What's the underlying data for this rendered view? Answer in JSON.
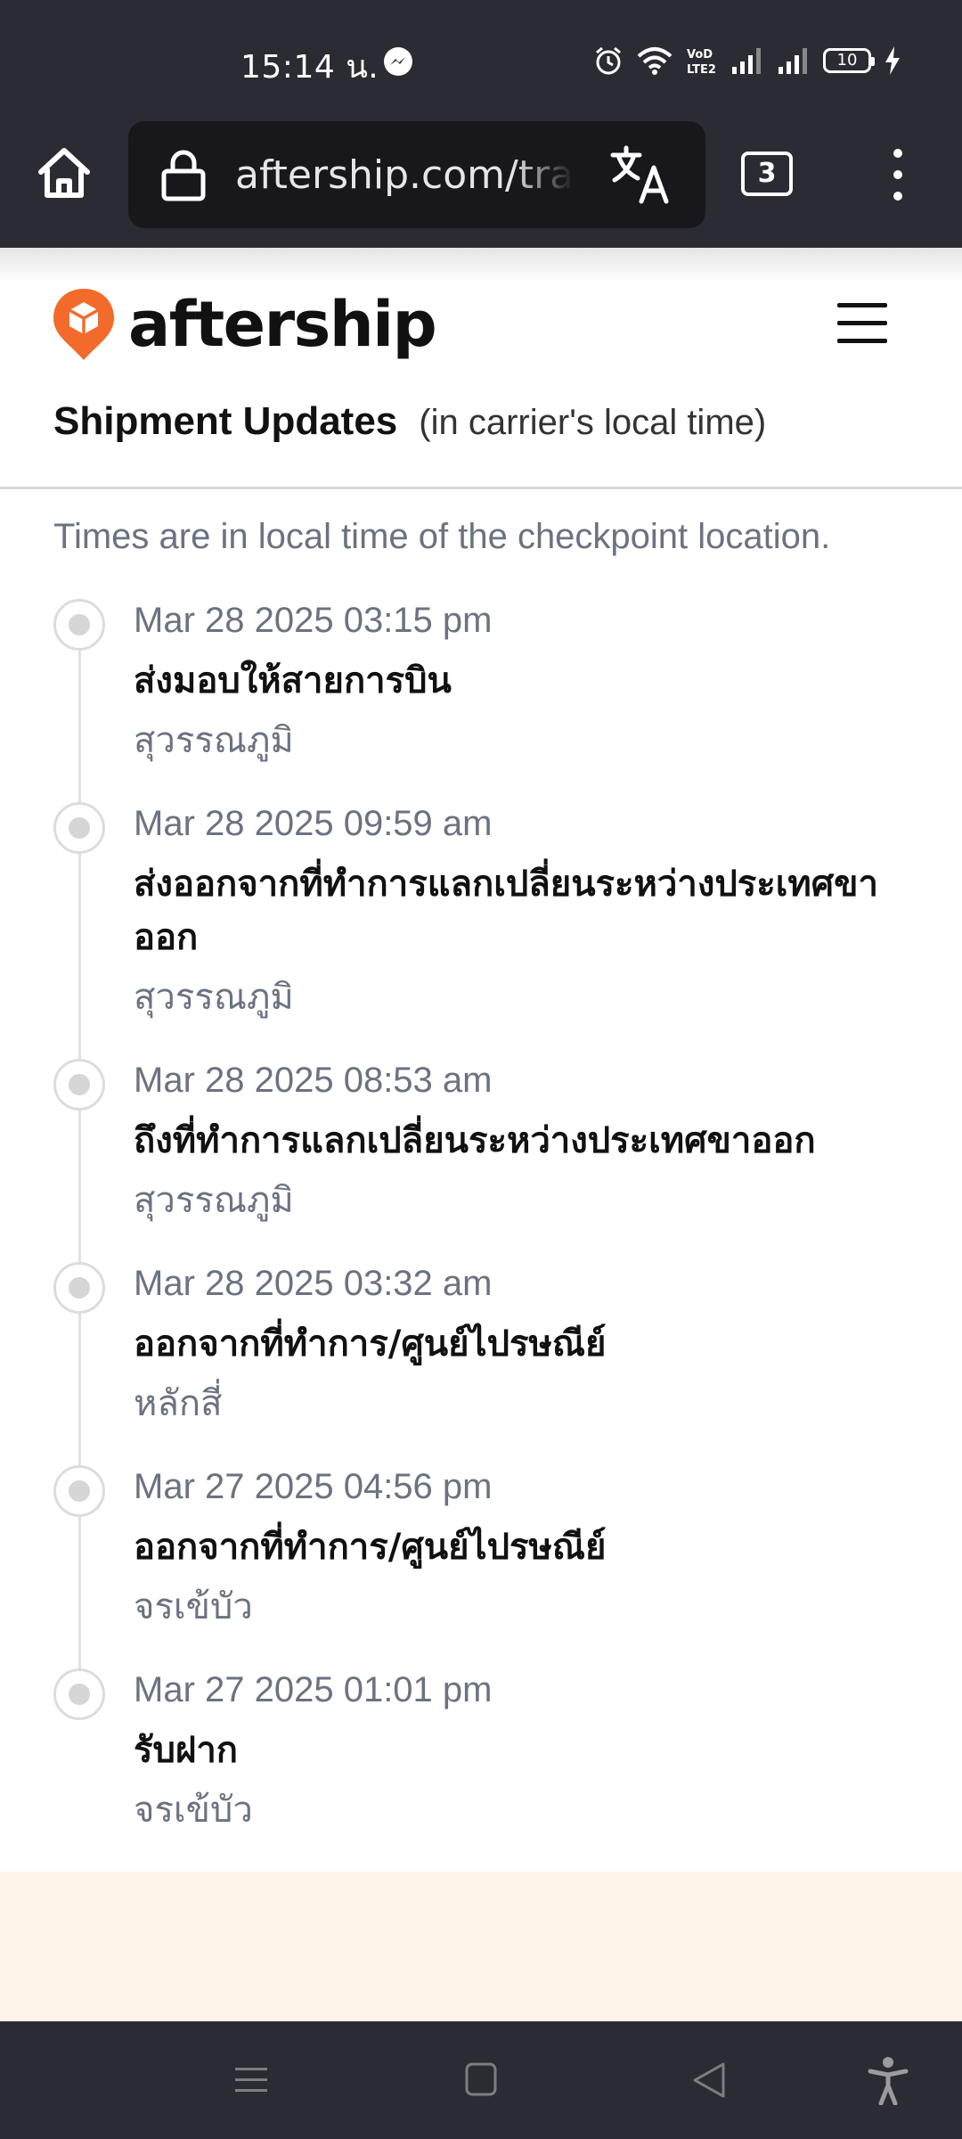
{
  "status_bar": {
    "time": "15:14 น.",
    "battery": "10",
    "icons": [
      "messenger-icon",
      "alarm-icon",
      "wifi-icon",
      "volte-icon",
      "signal-icon",
      "signal-icon",
      "battery-icon",
      "charging-icon"
    ]
  },
  "browser": {
    "url": "aftership.com/track",
    "tab_count": "3",
    "icons": [
      "home-icon",
      "lock-icon",
      "translate-icon",
      "more-icon"
    ]
  },
  "header": {
    "brand": "aftership",
    "brand_color": "#f26b2a",
    "icons": [
      "aftership-logo-icon",
      "hamburger-icon"
    ]
  },
  "section": {
    "title": "Shipment Updates",
    "subtitle": "(in carrier's local time)",
    "note": "Times are in local time of the checkpoint location."
  },
  "checkpoints": [
    {
      "time": "Mar 28 2025 03:15 pm",
      "status": "ส่งมอบให้สายการบิน",
      "location": "สุวรรณภูมิ"
    },
    {
      "time": "Mar 28 2025 09:59 am",
      "status": "ส่งออกจากที่ทำการแลกเปลี่ยนระหว่างประเทศขาออก",
      "location": "สุวรรณภูมิ"
    },
    {
      "time": "Mar 28 2025 08:53 am",
      "status": "ถึงที่ทำการแลกเปลี่ยนระหว่างประเทศขาออก",
      "location": "สุวรรณภูมิ"
    },
    {
      "time": "Mar 28 2025 03:32 am",
      "status": "ออกจากที่ทำการ/ศูนย์ไปรษณีย์",
      "location": "หลักสี่"
    },
    {
      "time": "Mar 27 2025 04:56 pm",
      "status": "ออกจากที่ทำการ/ศูนย์ไปรษณีย์",
      "location": "จรเข้บัว"
    },
    {
      "time": "Mar 27 2025 01:01 pm",
      "status": "รับฝาก",
      "location": "จรเข้บัว"
    }
  ],
  "nav_bar": {
    "icons": [
      "recent-apps-icon",
      "home-square-icon",
      "back-icon",
      "accessibility-icon"
    ]
  }
}
